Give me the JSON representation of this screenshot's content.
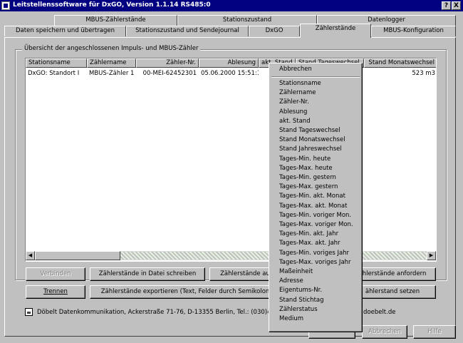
{
  "window": {
    "title": "Leitstellenssoftware für DxGO, Version 1.1.14    RS485:0",
    "help_label": "?",
    "close_label": "X"
  },
  "tabs_row1": [
    {
      "label": "MBUS-Zählerstände"
    },
    {
      "label": "Stationszustand"
    },
    {
      "label": "Datenlogger"
    }
  ],
  "tabs_row2": [
    {
      "label": "Daten speichern und übertragen"
    },
    {
      "label": "Stationszustand und Sendejournal"
    },
    {
      "label": "DxGO"
    },
    {
      "label": "Zählerstände",
      "active": true
    },
    {
      "label": "MBUS-Konfiguration"
    }
  ],
  "group": {
    "title": "Übersicht der angeschlossenen Impuls- und MBUS-Zähler"
  },
  "list": {
    "columns": [
      "Stationsname",
      "Zählername",
      "Zähler-Nr.",
      "Ablesung",
      "akt. Stand",
      "Stand Tageswechsel",
      "Stand Monatswechsel"
    ],
    "rows": [
      {
        "stationsname": "DxGO: Standort I",
        "zaehlername": "MBUS-Zähler 1",
        "zaehler_nr": "00-MEI-62452301",
        "ablesung": "05.06.2000  15:51:15",
        "stand_monatswechsel": "523 m3"
      }
    ]
  },
  "buttons": {
    "verbinden": "Verbinden",
    "in_datei": "Zählerstände in Datei schreiben",
    "zaehlerstaende_au": "Zählerstände au",
    "anfordern": "ählerstände anfordern",
    "trennen": "Trennen",
    "exportieren": "Zählerstände exportieren (Text, Felder durch Semikolon",
    "setzen": "ählerstand setzen",
    "abbrechen": "Abbrechen",
    "hilfe": "Hilfe"
  },
  "footer": {
    "text_left": "Döbelt Datenkommunikation, Ackerstraße 71-76, D-13355 Berlin, Tel.: (030)4630761",
    "text_right": "doebelt.de"
  },
  "context_menu": {
    "first_item": "Abbrechen",
    "items": [
      "Stationsname",
      "Zählername",
      "Zähler-Nr.",
      "Ablesung",
      "akt. Stand",
      "Stand Tageswechsel",
      "Stand Monatswechsel",
      "Stand Jahreswechsel",
      "Tages-Min. heute",
      "Tages-Max. heute",
      "Tages-Min. gestern",
      "Tages-Max. gestern",
      "Tages-Min. akt. Monat",
      "Tages-Max. akt. Monat",
      "Tages-Min. voriger Mon.",
      "Tages-Max. voriger Mon.",
      "Tages-Min. akt. Jahr",
      "Tages-Max. akt. Jahr",
      "Tages-Min. voriges Jahr",
      "Tages-Max. voriges Jahr",
      "Maßeinheit",
      "Adresse",
      "Eigentums-Nr.",
      "Stand Stichtag",
      "Zählerstatus",
      "Medium"
    ]
  }
}
